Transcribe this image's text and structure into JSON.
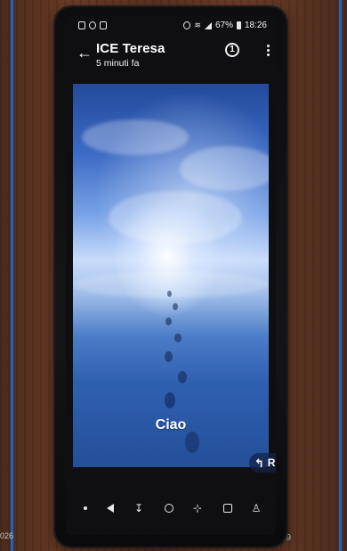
{
  "status_bar": {
    "battery": "67%",
    "time": "18:26"
  },
  "header": {
    "contact_name": "ICE Teresa",
    "last_seen": "5 minuti fa",
    "timer_label": "1"
  },
  "message": {
    "text": "Ciao"
  },
  "reply": {
    "label": "Rispondi"
  },
  "slide": {
    "footer_left": "026",
    "page_number": "19"
  },
  "icons": {
    "back": "arrow-left-icon",
    "timer": "timer-icon",
    "more": "more-vertical-icon",
    "reply": "reply-arrow-icon"
  }
}
